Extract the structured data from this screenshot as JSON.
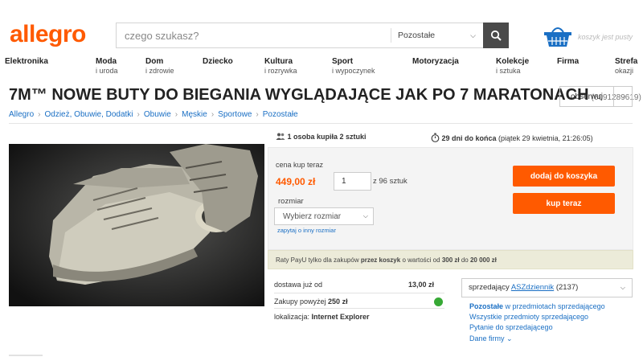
{
  "header": {
    "logo": "allegro",
    "search_placeholder": "czego szukasz?",
    "category": "Pozostałe",
    "cart_text": "koszyk jest pusty"
  },
  "nav": [
    {
      "label": "Elektronika",
      "sub": ""
    },
    {
      "label": "Moda",
      "sub": "i uroda"
    },
    {
      "label": "Dom",
      "sub": "i zdrowie"
    },
    {
      "label": "Dziecko",
      "sub": ""
    },
    {
      "label": "Kultura",
      "sub": "i rozrywka"
    },
    {
      "label": "Sport",
      "sub": "i wypoczynek"
    },
    {
      "label": "Motoryzacja",
      "sub": ""
    },
    {
      "label": "Kolekcje",
      "sub": "i sztuka"
    },
    {
      "label": "Firma",
      "sub": ""
    },
    {
      "label": "Strefa",
      "sub": "okazji"
    }
  ],
  "product": {
    "title": "7M™ NOWE BUTY DO BIEGANIA WYGLĄDAJĄCE JAK PO 7 MARATONACH",
    "id": "(6091289619)",
    "watch_label": "obserwuj"
  },
  "breadcrumbs": [
    "Allegro",
    "Odzież, Obuwie, Dodatki",
    "Obuwie",
    "Męskie",
    "Sportowe",
    "Pozostałe"
  ],
  "stats": {
    "buyers_bold": "1 osoba kupiła 2 sztuki",
    "timer_bold": "29 dni do końca",
    "timer_rest": "(piątek 29 kwietnia, 21:26:05)"
  },
  "offer": {
    "price_label": "cena kup teraz",
    "price": "449,00 zł",
    "qty_value": "1",
    "qty_note": "z 96 sztuk",
    "size_label": "rozmiar",
    "size_placeholder": "Wybierz rozmiar",
    "size_link": "zapytaj o inny rozmiar",
    "add_to_cart": "dodaj do koszyka",
    "buy_now": "kup teraz"
  },
  "payu": {
    "p1": "Raty PayU tylko dla zakupów",
    "b1": "przez koszyk",
    "p2": "o wartości od",
    "b2": "300 zł",
    "p3": "do",
    "b3": "20 000 zł"
  },
  "shipping": {
    "delivery_label": "dostawa już od",
    "delivery_value": "13,00 zł",
    "free_label": "Zakupy powyżej",
    "free_value": "250 zł",
    "location_label": "lokalizacja:",
    "location_value": "Internet Explorer"
  },
  "seller": {
    "label": "sprzedający",
    "name": "ASZdziennik",
    "rating": "(2137)",
    "links_bold": "Pozostałe",
    "links_rest": "w przedmiotach sprzedającego",
    "link2": "Wszystkie przedmioty sprzedającego",
    "link3": "Pytanie do sprzedającego",
    "link4": "Dane firmy"
  },
  "colors": {
    "brand": "#ff5a00",
    "link": "#1a6fc4"
  }
}
